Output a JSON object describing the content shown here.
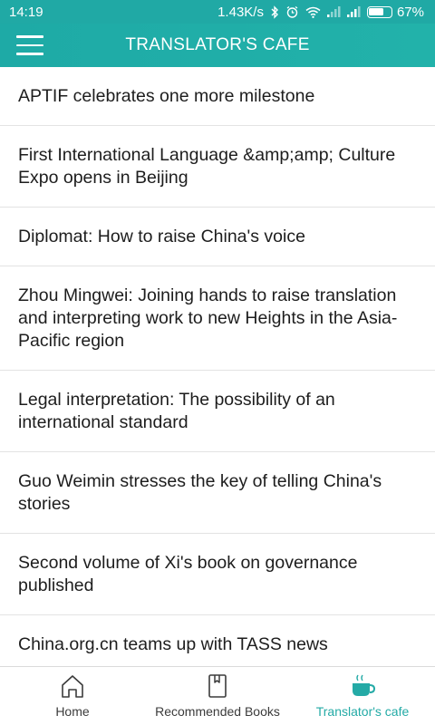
{
  "status_bar": {
    "time": "14:19",
    "network_speed": "1.43K/s",
    "battery_percent": "67%",
    "battery_level": 0.67
  },
  "app_bar": {
    "title": "TRANSLATOR'S CAFE",
    "menu_icon": "hamburger-menu-icon"
  },
  "articles": [
    {
      "title": "APTIF celebrates one more milestone"
    },
    {
      "title": "First International Language &amp;amp; Culture Expo opens in Beijing"
    },
    {
      "title": "Diplomat: How to raise China's voice"
    },
    {
      "title": "Zhou Mingwei: Joining hands to raise translation and interpreting work to new Heights in the Asia-Pacific region"
    },
    {
      "title": "Legal interpretation: The possibility of an international standard"
    },
    {
      "title": "Guo Weimin stresses the key of telling China's stories"
    },
    {
      "title": "Second volume of Xi's book on governance published"
    },
    {
      "title": "China.org.cn teams up with TASS news"
    }
  ],
  "bottom_nav": {
    "items": [
      {
        "label": "Home",
        "icon": "home-icon",
        "active": false
      },
      {
        "label": "Recommended Books",
        "icon": "book-icon",
        "active": false
      },
      {
        "label": "Translator's cafe",
        "icon": "coffee-cup-icon",
        "active": true
      }
    ]
  },
  "colors": {
    "primary": "#20a9a5",
    "active_nav": "#24aaa6",
    "text": "#1d1d1d",
    "divider": "#e3e3e3"
  }
}
